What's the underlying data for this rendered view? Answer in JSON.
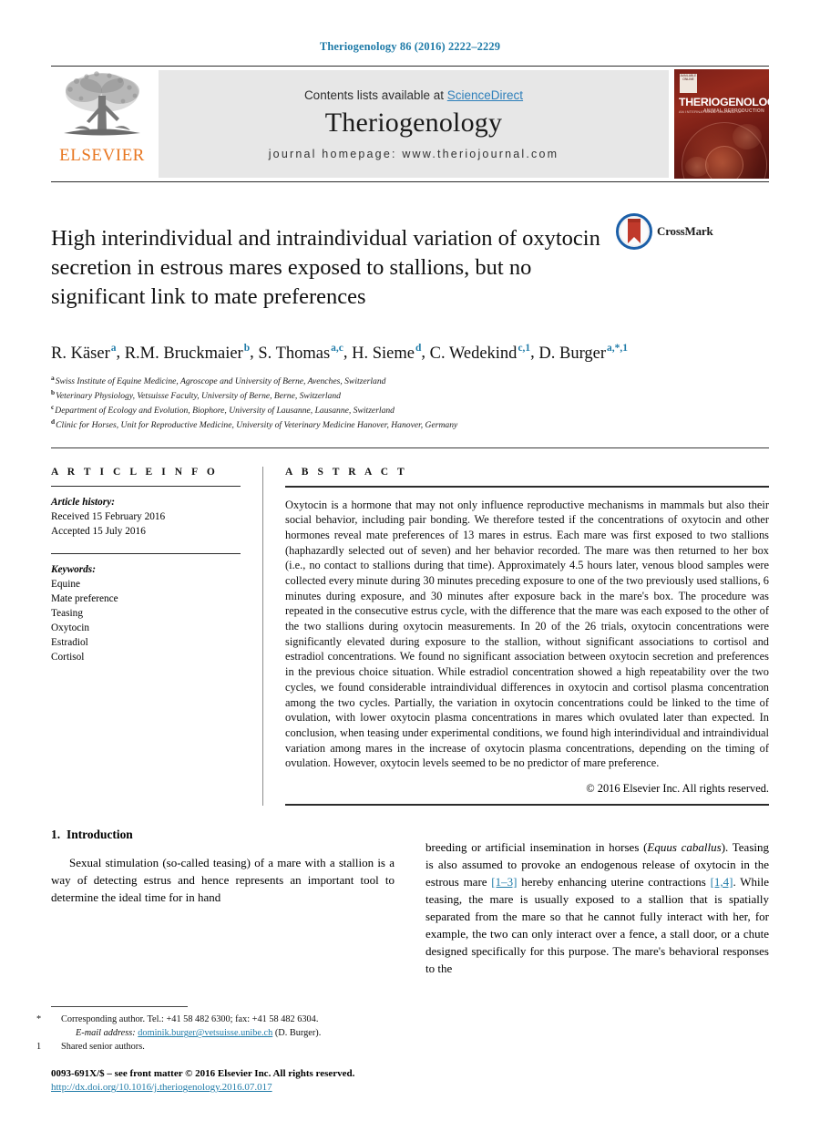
{
  "running_head": "Theriogenology 86 (2016) 2222–2229",
  "masthead": {
    "publisher_logo_text": "ELSEVIER",
    "contents_prefix": "Contents lists available at ",
    "contents_link": "ScienceDirect",
    "journal_title": "Theriogenology",
    "homepage": "journal homepage: www.theriojournal.com",
    "cover": {
      "badge_text": "AVAILABLE ONLINE",
      "title": "THERIOGENOLOGY",
      "subtitle": "AN INTERNATIONAL JOURNAL OF",
      "subtitle2": "ANIMAL REPRODUCTION"
    }
  },
  "article": {
    "title": "High interindividual and intraindividual variation of oxytocin secretion in estrous mares exposed to stallions, but no significant link to mate preferences",
    "crossmark_label": "CrossMark",
    "authors": [
      {
        "name": "R. Käser",
        "marks": "a"
      },
      {
        "name": "R.M. Bruckmaier",
        "marks": "b"
      },
      {
        "name": "S. Thomas",
        "marks": "a,c"
      },
      {
        "name": "H. Sieme",
        "marks": "d"
      },
      {
        "name": "C. Wedekind",
        "marks": "c,1"
      },
      {
        "name": "D. Burger",
        "marks": "a,*,1"
      }
    ],
    "affiliations": [
      {
        "mark": "a",
        "text": "Swiss Institute of Equine Medicine, Agroscope and University of Berne, Avenches, Switzerland"
      },
      {
        "mark": "b",
        "text": "Veterinary Physiology, Vetsuisse Faculty, University of Berne, Berne, Switzerland"
      },
      {
        "mark": "c",
        "text": "Department of Ecology and Evolution, Biophore, University of Lausanne, Lausanne, Switzerland"
      },
      {
        "mark": "d",
        "text": "Clinic for Horses, Unit for Reproductive Medicine, University of Veterinary Medicine Hanover, Hanover, Germany"
      }
    ]
  },
  "article_info": {
    "heading": "A R T I C L E  I N F O",
    "history_label": "Article history:",
    "history": [
      "Received 15 February 2016",
      "Accepted 15 July 2016"
    ],
    "keywords_label": "Keywords:",
    "keywords": [
      "Equine",
      "Mate preference",
      "Teasing",
      "Oxytocin",
      "Estradiol",
      "Cortisol"
    ]
  },
  "abstract": {
    "heading": "A B S T R A C T",
    "text": "Oxytocin is a hormone that may not only influence reproductive mechanisms in mammals but also their social behavior, including pair bonding. We therefore tested if the concentrations of oxytocin and other hormones reveal mate preferences of 13 mares in estrus. Each mare was first exposed to two stallions (haphazardly selected out of seven) and her behavior recorded. The mare was then returned to her box (i.e., no contact to stallions during that time). Approximately 4.5 hours later, venous blood samples were collected every minute during 30 minutes preceding exposure to one of the two previously used stallions, 6 minutes during exposure, and 30 minutes after exposure back in the mare's box. The procedure was repeated in the consecutive estrus cycle, with the difference that the mare was each exposed to the other of the two stallions during oxytocin measurements. In 20 of the 26 trials, oxytocin concentrations were significantly elevated during exposure to the stallion, without significant associations to cortisol and estradiol concentrations. We found no significant association between oxytocin secretion and preferences in the previous choice situation. While estradiol concentration showed a high repeatability over the two cycles, we found considerable intraindividual differences in oxytocin and cortisol plasma concentration among the two cycles. Partially, the variation in oxytocin concentrations could be linked to the time of ovulation, with lower oxytocin plasma concentrations in mares which ovulated later than expected. In conclusion, when teasing under experimental conditions, we found high interindividual and intraindividual variation among mares in the increase of oxytocin plasma concentrations, depending on the timing of ovulation. However, oxytocin levels seemed to be no predictor of mare preference.",
    "copyright": "© 2016 Elsevier Inc. All rights reserved."
  },
  "body": {
    "section_number": "1.",
    "section_title": "Introduction",
    "left_paragraph": "Sexual stimulation (so-called teasing) of a mare with a stallion is a way of detecting estrus and hence represents an important tool to determine the ideal time for in hand",
    "right_paragraph_parts": {
      "p1": "breeding or artificial insemination in horses (",
      "species": "Equus caballus",
      "p2": "). Teasing is also assumed to provoke an endogenous release of oxytocin in the estrous mare ",
      "ref1": "[1–3]",
      "p3": " hereby enhancing uterine contractions ",
      "ref2": "[1,4]",
      "p4": ". While teasing, the mare is usually exposed to a stallion that is spatially separated from the mare so that he cannot fully interact with her, for example, the two can only interact over a fence, a stall door, or a chute designed specifically for this purpose. The mare's behavioral responses to the"
    }
  },
  "footnotes": {
    "corresponding_mark": "*",
    "corresponding_text": "Corresponding author. Tel.: +41 58 482 6300; fax: +41 58 482 6304.",
    "email_label": "E-mail address:",
    "email": "dominik.burger@vetsuisse.unibe.ch",
    "email_suffix": "(D. Burger).",
    "shared_mark": "1",
    "shared_text": "Shared senior authors.",
    "issn_line": "0093-691X/$ – see front matter © 2016 Elsevier Inc. All rights reserved.",
    "doi": "http://dx.doi.org/10.1016/j.theriogenology.2016.07.017"
  }
}
